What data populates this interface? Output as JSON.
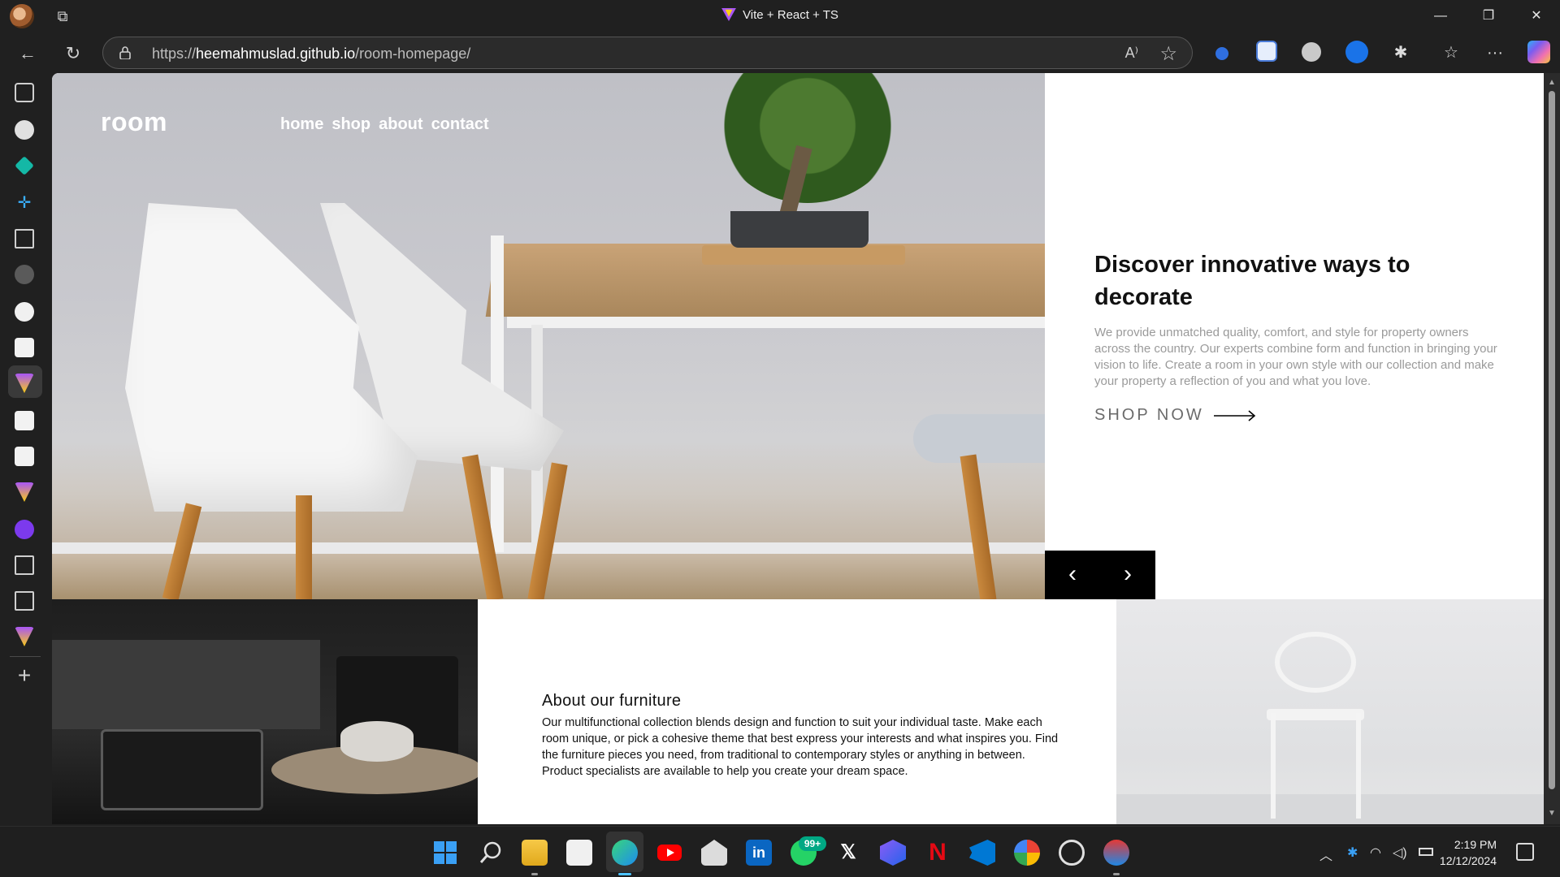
{
  "window": {
    "title": "Vite + React + TS",
    "minimize_glyph": "—",
    "restore_glyph": "❐",
    "close_glyph": "✕"
  },
  "browser": {
    "url_prefix": "https://",
    "url_domain": "heemahmuslad.github.io",
    "url_path": "/room-homepage/",
    "read_aloud_glyph": "A⁾",
    "back_glyph": "←",
    "refresh_glyph": "↻",
    "favorite_glyph": "☆",
    "more_glyph": "···"
  },
  "page": {
    "logo": "room",
    "nav": [
      "home",
      "shop",
      "about",
      "contact"
    ],
    "hero": {
      "title": "Discover innovative ways to decorate",
      "description": "We provide unmatched quality, comfort, and style for property owners across the country. Our experts combine form and function in bringing your vision to life. Create a room in your own style with our collection and make your property a reflection of you and what you love.",
      "cta": "SHOP NOW",
      "prev_glyph": "‹",
      "next_glyph": "›"
    },
    "about": {
      "title": "About our furniture",
      "description": "Our multifunctional collection blends design and function to suit your individual taste. Make each room unique, or pick a cohesive theme that best express your interests and what inspires you. Find the furniture pieces you need, from traditional to contemporary styles or anything in between. Product specialists are available to help you create your dream space."
    }
  },
  "taskbar": {
    "whatsapp_badge": "99+",
    "clock_time": "2:19 PM",
    "clock_date": "12/12/2024"
  },
  "colors": {
    "accent_whatsapp": "#00a884",
    "youtube": "#ff0000",
    "netflix": "#e50914",
    "linkedin": "#0a66c2",
    "vscode": "#0078d4"
  }
}
